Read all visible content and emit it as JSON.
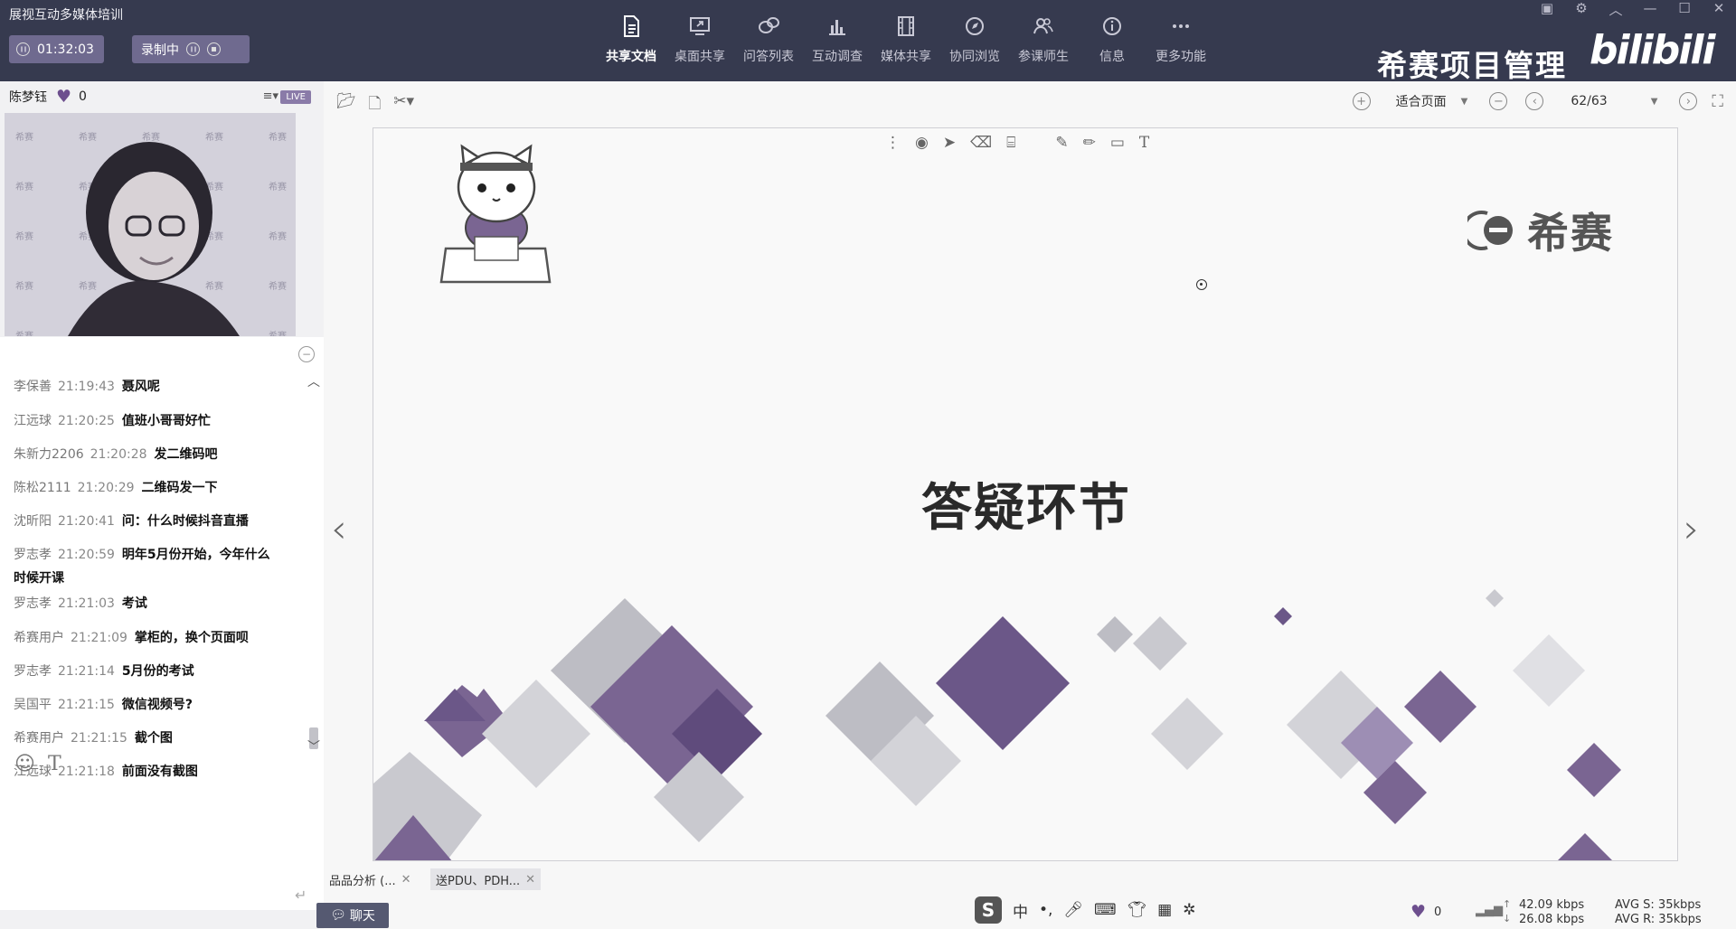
{
  "app": {
    "title": "展视互动多媒体培训",
    "timer": "01:32:03",
    "recording_label": "录制中"
  },
  "toolbar": {
    "items": [
      {
        "label": "共享文档",
        "icon": "document-icon",
        "active": true
      },
      {
        "label": "桌面共享",
        "icon": "desktop-share-icon",
        "active": false
      },
      {
        "label": "问答列表",
        "icon": "qa-bubble-icon",
        "active": false
      },
      {
        "label": "互动调查",
        "icon": "bar-chart-icon",
        "active": false
      },
      {
        "label": "媒体共享",
        "icon": "film-icon",
        "active": false
      },
      {
        "label": "协同浏览",
        "icon": "compass-icon",
        "active": false
      },
      {
        "label": "参课师生",
        "icon": "people-icon",
        "active": false
      },
      {
        "label": "信息",
        "icon": "info-icon",
        "active": false
      },
      {
        "label": "更多功能",
        "icon": "more-icon",
        "active": false
      }
    ]
  },
  "brand": {
    "text": "希赛项目管理",
    "bilibili": "bilibili"
  },
  "presenter": {
    "name": "陈梦钰",
    "likes": "0",
    "live": "LIVE"
  },
  "chat": {
    "messages": [
      {
        "name": "李保善",
        "time": "21:19:43",
        "text": "聂风呢"
      },
      {
        "name": "江远球",
        "time": "21:20:25",
        "text": "值班小哥哥好忙"
      },
      {
        "name": "朱新力2206",
        "time": "21:20:28",
        "text": "发二维码吧"
      },
      {
        "name": "陈松2111",
        "time": "21:20:29",
        "text": "二维码发一下"
      },
      {
        "name": "沈昕阳",
        "time": "21:20:41",
        "text": "问：什么时候抖音直播"
      },
      {
        "name": "罗志孝",
        "time": "21:20:59",
        "text": "明年5月份开始，今年什么时候开课"
      },
      {
        "name": "罗志孝",
        "time": "21:21:03",
        "text": "考试"
      },
      {
        "name": "希赛用户",
        "time": "21:21:09",
        "text": "掌柜的，换个页面呗"
      },
      {
        "name": "罗志孝",
        "time": "21:21:14",
        "text": "5月份的考试"
      },
      {
        "name": "吴国平",
        "time": "21:21:15",
        "text": "微信视频号?"
      },
      {
        "name": "希赛用户",
        "time": "21:21:15",
        "text": "截个图"
      },
      {
        "name": "江远球",
        "time": "21:21:18",
        "text": "前面没有截图"
      }
    ],
    "tab_label": "聊天"
  },
  "document": {
    "zoom_mode": "适合页面",
    "page": "62/63",
    "slide_title": "答疑环节",
    "slide_logo_text": "希赛",
    "tabs": [
      {
        "label": "品品分析 (..."
      },
      {
        "label": "送PDU、PDH..."
      }
    ]
  },
  "status": {
    "likes": "0",
    "up_rate": "42.09 kbps",
    "down_rate": "26.08 kbps",
    "avg_s": "AVG S: 35kbps",
    "avg_r": "AVG R: 35kbps"
  },
  "ime": {
    "logo": "S",
    "mode": "中"
  },
  "colors": {
    "topbar": "#363a4f",
    "accent_purple": "#6d4f8e",
    "pill": "#6f6a8f"
  }
}
